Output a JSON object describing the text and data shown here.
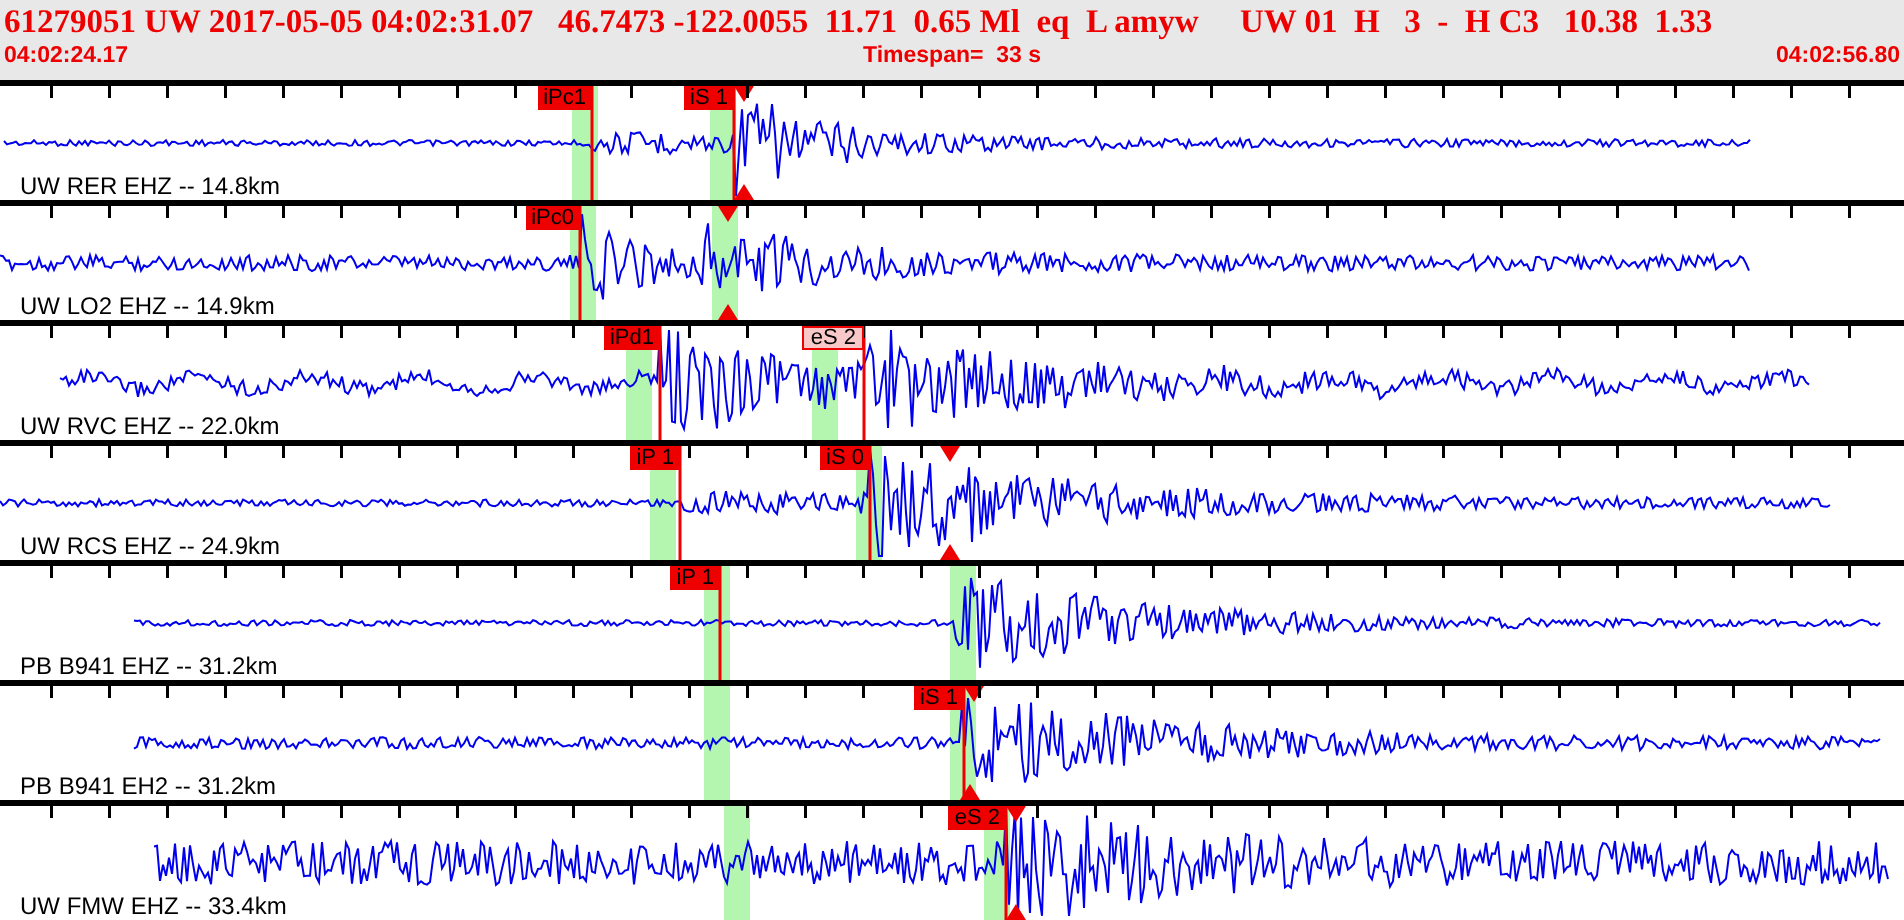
{
  "header": {
    "summary": "61279051 UW 2017-05-05 04:02:31.07   46.7473 -122.0055  11.71  0.65 Ml  eq  L amyw     UW 01  H   3  -  H C3   10.38  1.33",
    "start_time": "04:02:24.17",
    "timespan": "Timespan=  33 s",
    "end_time": "04:02:56.80"
  },
  "traces": [
    {
      "label": "UW RER EHZ -- 14.8km",
      "picks": [
        {
          "label": "iPc1",
          "kind": "solid"
        },
        {
          "label": "iS 1",
          "kind": "solid"
        }
      ]
    },
    {
      "label": "UW LO2 EHZ -- 14.9km",
      "picks": [
        {
          "label": "iPc0",
          "kind": "solid"
        }
      ]
    },
    {
      "label": "UW RVC EHZ -- 22.0km",
      "picks": [
        {
          "label": "iPd1",
          "kind": "solid"
        },
        {
          "label": "eS 2",
          "kind": "pale"
        }
      ]
    },
    {
      "label": "UW RCS EHZ -- 24.9km",
      "picks": [
        {
          "label": "iP 1",
          "kind": "solid"
        },
        {
          "label": "iS 0",
          "kind": "solid"
        }
      ]
    },
    {
      "label": "PB B941 EHZ -- 31.2km",
      "picks": [
        {
          "label": "iP 1",
          "kind": "solid"
        }
      ]
    },
    {
      "label": "PB B941 EH2 -- 31.2km",
      "picks": [
        {
          "label": "iS 1",
          "kind": "solid"
        }
      ]
    },
    {
      "label": "UW FMW EHZ -- 33.4km",
      "picks": [
        {
          "label": "eS 2",
          "kind": "solid"
        }
      ]
    }
  ]
}
